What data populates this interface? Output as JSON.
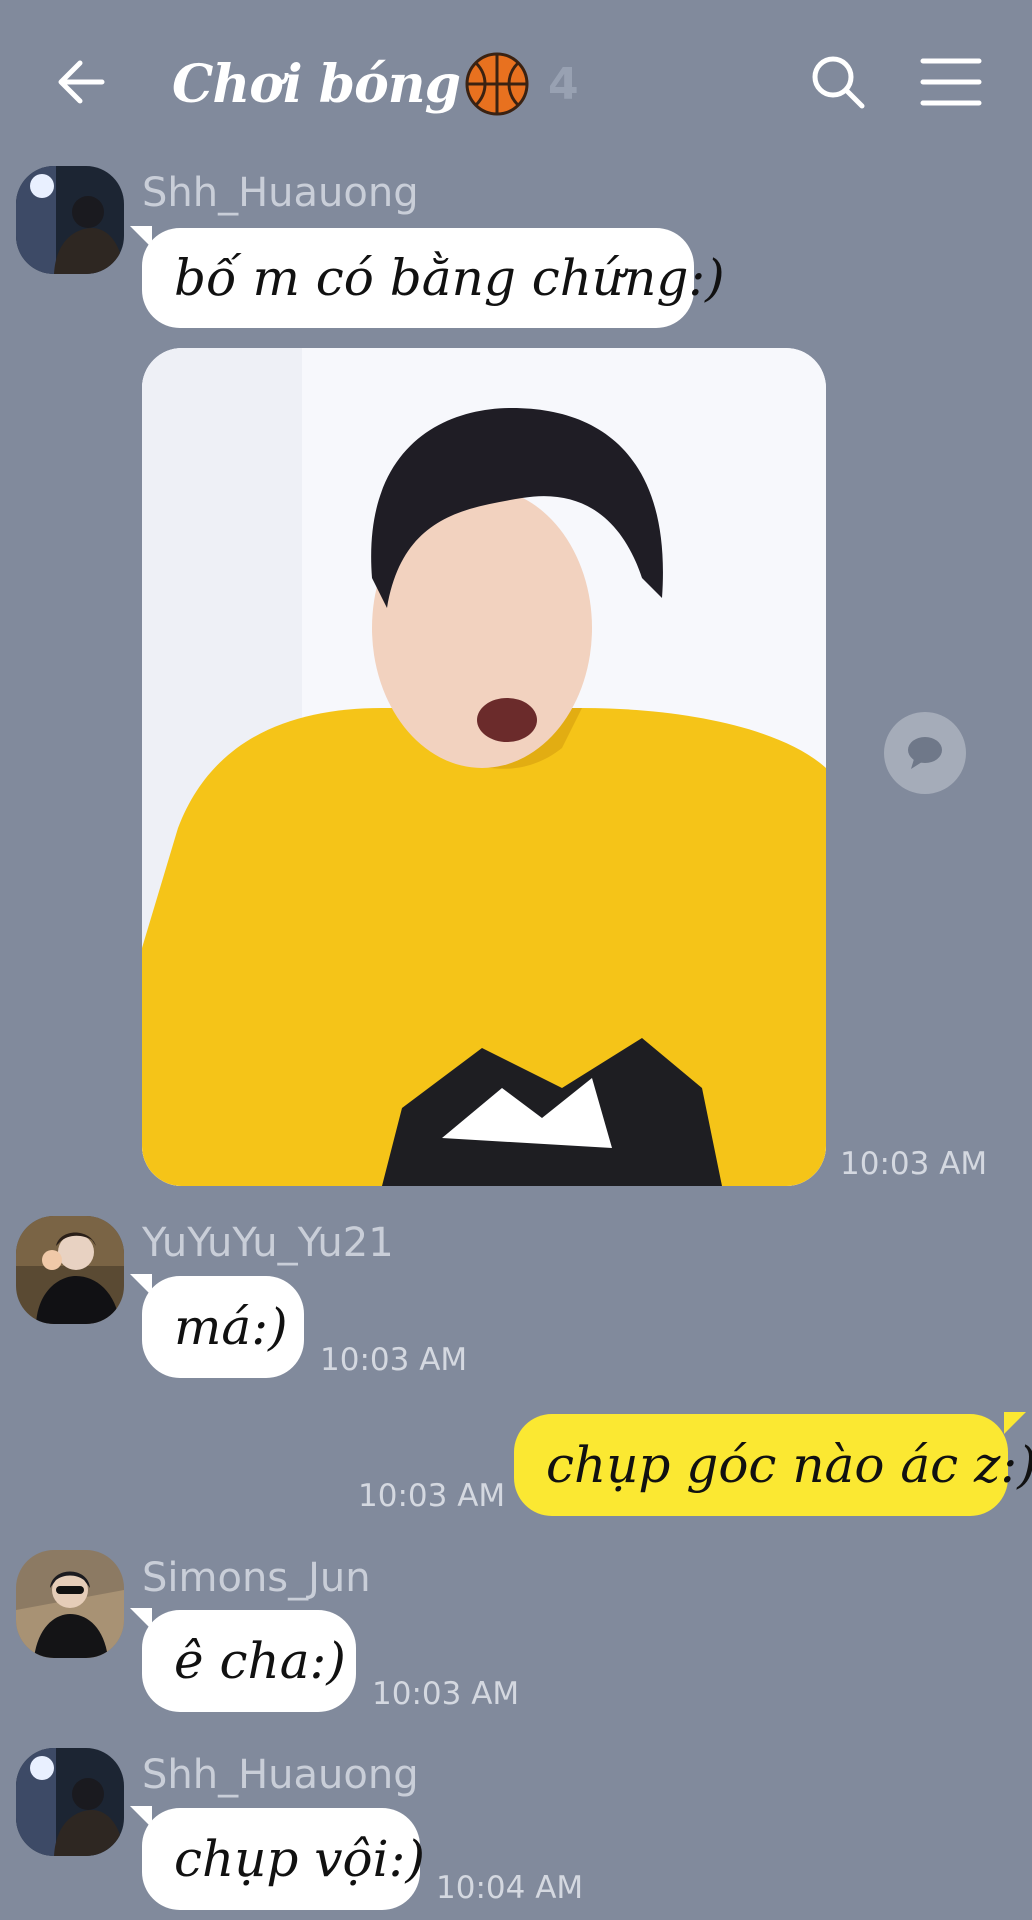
{
  "header": {
    "back_icon": "arrow-left-icon",
    "title": "Chơi bóng",
    "emoji": "basketball-icon",
    "member_count": "4",
    "search_icon": "search-icon",
    "menu_icon": "hamburger-menu-icon"
  },
  "messages": [
    {
      "sender": "Shh_Huauong",
      "text": "bố m có bằng chứng:)"
    },
    {
      "sender": "Shh_Huauong",
      "type": "image",
      "time": "10:03 AM"
    },
    {
      "sender": "YuYuYu_Yu21",
      "text": "má:)",
      "time": "10:03 AM"
    },
    {
      "sender": "me",
      "text": "chụp góc nào ác z:)",
      "time": "10:03 AM"
    },
    {
      "sender": "Simons_Jun",
      "text": "ê cha:)",
      "time": "10:03 AM"
    },
    {
      "sender": "Shh_Huauong",
      "text": "chụp vội:)",
      "time": "10:04 AM"
    }
  ],
  "colors": {
    "background": "#818a9c",
    "my_bubble": "#fbe832",
    "other_bubble": "#ffffff",
    "accent_text": "#c9ced8"
  }
}
